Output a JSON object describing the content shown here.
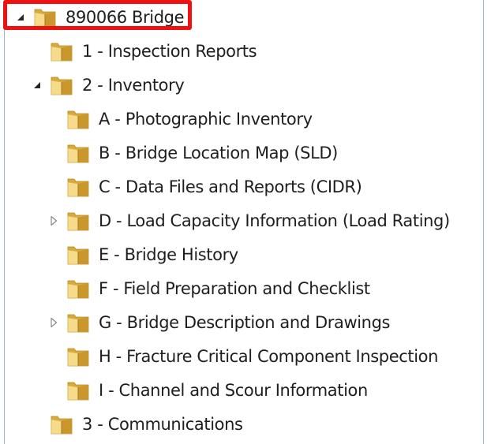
{
  "tree": {
    "items": [
      {
        "label": "890066 Bridge",
        "level": 0,
        "toggle": "expanded",
        "icon": "folder-icon",
        "selected": true
      },
      {
        "label": "1 - Inspection Reports",
        "level": 1,
        "toggle": "none",
        "icon": "folder-icon"
      },
      {
        "label": "2 - Inventory",
        "level": 1,
        "toggle": "expanded",
        "icon": "folder-icon"
      },
      {
        "label": "A - Photographic Inventory",
        "level": 2,
        "toggle": "none",
        "icon": "folder-icon"
      },
      {
        "label": "B - Bridge Location Map (SLD)",
        "level": 2,
        "toggle": "none",
        "icon": "folder-icon"
      },
      {
        "label": "C - Data Files and Reports (CIDR)",
        "level": 2,
        "toggle": "none",
        "icon": "folder-icon"
      },
      {
        "label": "D - Load Capacity Information (Load Rating)",
        "level": 2,
        "toggle": "collapsed",
        "icon": "folder-icon"
      },
      {
        "label": "E - Bridge History",
        "level": 2,
        "toggle": "none",
        "icon": "folder-icon"
      },
      {
        "label": "F - Field Preparation and Checklist",
        "level": 2,
        "toggle": "none",
        "icon": "folder-icon"
      },
      {
        "label": "G - Bridge Description and Drawings",
        "level": 2,
        "toggle": "collapsed",
        "icon": "folder-icon"
      },
      {
        "label": "H - Fracture Critical Component Inspection",
        "level": 2,
        "toggle": "none",
        "icon": "folder-icon"
      },
      {
        "label": "I - Channel and Scour Information",
        "level": 2,
        "toggle": "none",
        "icon": "folder-icon"
      },
      {
        "label": "3 - Communications",
        "level": 1,
        "toggle": "none",
        "icon": "folder-icon"
      }
    ]
  },
  "colors": {
    "highlight_border": "#ee1111",
    "text": "#1e1e1e",
    "folder_back": "#d9a93a",
    "folder_front": "#f6dc8a",
    "tree_border": "#9fb5cf"
  }
}
